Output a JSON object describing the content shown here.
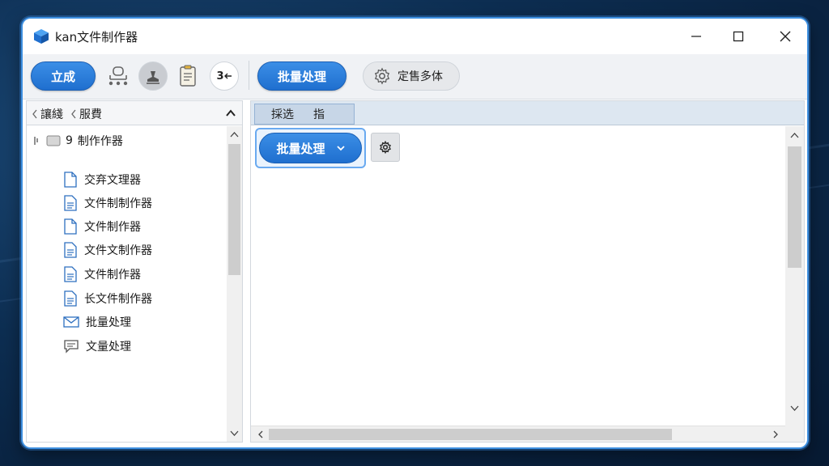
{
  "window": {
    "title": "kan文件制作器"
  },
  "toolbar": {
    "primary_label": "立成",
    "tool3_text": "3",
    "batch_label": "批量处理",
    "settings_label": "定售多体"
  },
  "left_panel": {
    "breadcrumb": [
      "讓綫",
      "服費"
    ],
    "root": {
      "number": "9",
      "label": "制作作器"
    },
    "items": [
      {
        "label": "交弃文理器",
        "icon": "file-icon"
      },
      {
        "label": "文件制制作器",
        "icon": "file-text-icon"
      },
      {
        "label": "文件制作器",
        "icon": "file-icon"
      },
      {
        "label": "文件文制作器",
        "icon": "file-text-icon"
      },
      {
        "label": "文件制作器",
        "icon": "file-text-icon"
      },
      {
        "label": "长文件制作器",
        "icon": "file-text-icon"
      },
      {
        "label": "批量处理",
        "icon": "mail-icon"
      },
      {
        "label": "文量处理",
        "icon": "chat-icon"
      }
    ]
  },
  "main": {
    "tab": {
      "left": "採选",
      "right": "指"
    },
    "batch_dropdown_label": "批量处理"
  },
  "colors": {
    "accent": "#1f6fcf",
    "border": "#3d8fe0"
  }
}
